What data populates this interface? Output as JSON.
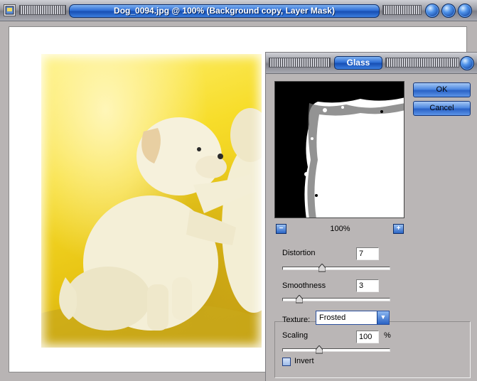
{
  "document": {
    "title": "Dog_0094.jpg @ 100% (Background copy, Layer Mask)",
    "icons": [
      "app-icon",
      "minimize-icon",
      "maximize-icon",
      "close-icon"
    ]
  },
  "dialog": {
    "title": "Glass",
    "ok_label": "OK",
    "cancel_label": "Cancel",
    "zoom_level": "100%",
    "zoom_out_symbol": "−",
    "zoom_in_symbol": "+",
    "distortion": {
      "label": "Distortion",
      "value": "7",
      "fraction": 0.35
    },
    "smoothness": {
      "label": "Smoothness",
      "value": "3",
      "fraction": 0.15
    },
    "texture": {
      "label": "Texture:",
      "selected": "Frosted"
    },
    "scaling": {
      "label": "Scaling",
      "value": "100",
      "unit": "%",
      "fraction": 0.33
    },
    "invert": {
      "label": "Invert",
      "checked": false
    }
  },
  "colors": {
    "accent_blue": "#2f6fd6",
    "window_gray": "#b8b4b4",
    "photo_yellow": "#f7dd2a"
  }
}
